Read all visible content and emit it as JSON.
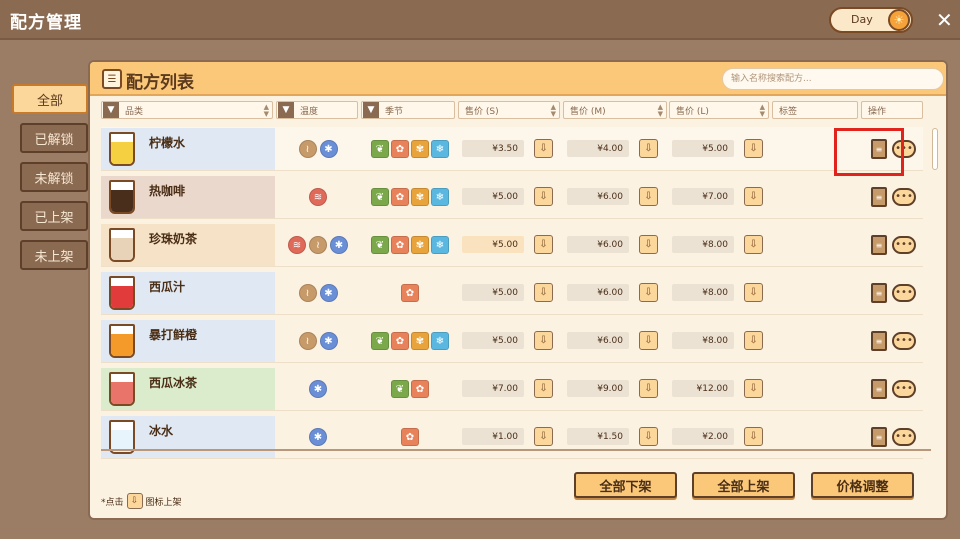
{
  "app": {
    "title": "配方管理",
    "mode_label": "Day"
  },
  "side_tabs": [
    {
      "label": "全部",
      "active": true
    },
    {
      "label": "已解锁",
      "active": false
    },
    {
      "label": "未解锁",
      "active": false
    },
    {
      "label": "已上架",
      "active": false
    },
    {
      "label": "未上架",
      "active": false
    }
  ],
  "panel": {
    "title": "配方列表",
    "search_placeholder": "输入名称搜索配方..."
  },
  "columns": {
    "category": "品类",
    "temperature": "温度",
    "season": "季节",
    "price_s": "售价 (S)",
    "price_m": "售价 (M)",
    "price_l": "售价 (L)",
    "tag": "标签",
    "actions": "操作"
  },
  "rows": [
    {
      "name": "柠檬水",
      "thumb_bg": "#dfe8f3",
      "liquid": "#f5d142",
      "temps": [
        "warm",
        "cold"
      ],
      "seasons": [
        "spring",
        "summer",
        "autumn",
        "winter"
      ],
      "price_s": "¥3.50",
      "price_m": "¥4.00",
      "price_l": "¥5.00"
    },
    {
      "name": "热咖啡",
      "thumb_bg": "#ead8cc",
      "liquid": "#4a2e1c",
      "temps": [
        "hot"
      ],
      "seasons": [
        "spring",
        "summer",
        "autumn",
        "winter"
      ],
      "price_s": "¥5.00",
      "price_m": "¥6.00",
      "price_l": "¥7.00"
    },
    {
      "name": "珍珠奶茶",
      "thumb_bg": "#f6e2c6",
      "liquid": "#e8d3b8",
      "temps": [
        "hot",
        "warm",
        "cold"
      ],
      "seasons": [
        "spring",
        "summer",
        "autumn",
        "winter"
      ],
      "price_s": "¥5.00",
      "price_m": "¥6.00",
      "price_l": "¥8.00"
    },
    {
      "name": "西瓜汁",
      "thumb_bg": "#dfe8f3",
      "liquid": "#e23b3b",
      "temps": [
        "warm",
        "cold"
      ],
      "seasons": [
        "summer"
      ],
      "price_s": "¥5.00",
      "price_m": "¥6.00",
      "price_l": "¥8.00"
    },
    {
      "name": "暴打鲜橙",
      "thumb_bg": "#dfe8f3",
      "liquid": "#f39a2b",
      "temps": [
        "warm",
        "cold"
      ],
      "seasons": [
        "spring",
        "summer",
        "autumn",
        "winter"
      ],
      "price_s": "¥5.00",
      "price_m": "¥6.00",
      "price_l": "¥8.00"
    },
    {
      "name": "西瓜冰茶",
      "thumb_bg": "#dbeccd",
      "liquid": "#e8746a",
      "temps": [
        "cold"
      ],
      "seasons": [
        "spring",
        "summer"
      ],
      "price_s": "¥7.00",
      "price_m": "¥9.00",
      "price_l": "¥12.00"
    },
    {
      "name": "冰水",
      "thumb_bg": "#dfe8f3",
      "liquid": "#e8f4fb",
      "temps": [
        "cold"
      ],
      "seasons": [
        "summer"
      ],
      "price_s": "¥1.00",
      "price_m": "¥1.50",
      "price_l": "¥2.00"
    }
  ],
  "buttons": {
    "delist_all": "全部下架",
    "list_all": "全部上架",
    "price_adjust": "价格调整"
  },
  "footnote": {
    "prefix": "*点击",
    "suffix": "图标上架"
  },
  "colors": {
    "accent": "#fbc87a",
    "highlight": "#e0231c",
    "hot": "#e06a5a",
    "warm": "#c79a6a",
    "cold": "#6b8fd6",
    "spring": "#7aa84a",
    "summer": "#e8825a",
    "autumn": "#e8a33a",
    "winter": "#5ab8e0"
  }
}
